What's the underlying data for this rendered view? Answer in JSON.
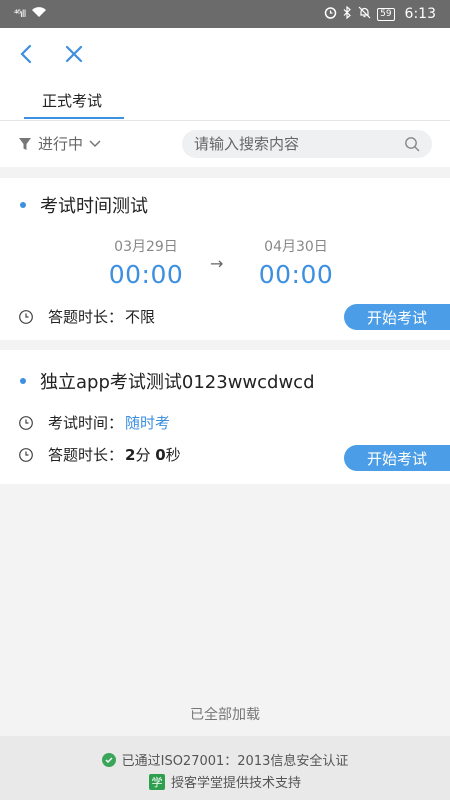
{
  "status_bar": {
    "signal": "⁴⁶ıll",
    "battery": "59",
    "time": "6:13"
  },
  "header": {
    "tab_label": "正式考试"
  },
  "filter": {
    "label": "进行中",
    "search_placeholder": "请输入搜索内容"
  },
  "exams": [
    {
      "title": "考试时间测试",
      "start_date": "03月29日",
      "start_time": "00:00",
      "end_date": "04月30日",
      "end_time": "00:00",
      "arrow": "→",
      "duration_label": "答题时长：",
      "duration_value": "不限",
      "button_label": "开始考试"
    },
    {
      "title": "独立app考试测试0123wwcdwcd",
      "time_label": "考试时间：",
      "time_value": "随时考",
      "duration_label": "答题时长：",
      "duration_num1": "2",
      "duration_unit1": "分 ",
      "duration_num2": "0",
      "duration_unit2": "秒",
      "button_label": "开始考试"
    }
  ],
  "list_end_text": "已全部加载",
  "footer": {
    "line1": "已通过ISO27001：2013信息安全认证",
    "line2": "授客学堂提供技术支持",
    "logo_char": "学"
  },
  "colors": {
    "accent": "#3d8fe0",
    "button": "#4a9de6",
    "status_bar": "#6b6b6b"
  }
}
